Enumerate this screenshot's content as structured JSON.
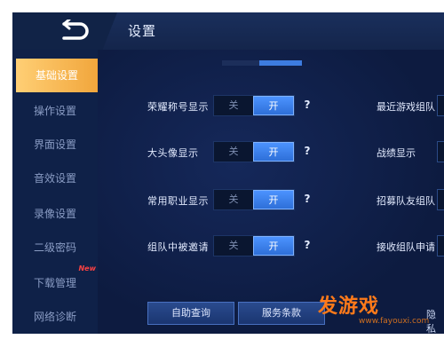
{
  "header": {
    "title": "设置"
  },
  "sidebar": {
    "items": [
      {
        "label": "基础设置",
        "active": true
      },
      {
        "label": "操作设置"
      },
      {
        "label": "界面设置"
      },
      {
        "label": "音效设置"
      },
      {
        "label": "录像设置"
      },
      {
        "label": "二级密码"
      },
      {
        "label": "下载管理",
        "badge": "New"
      },
      {
        "label": "网络诊断"
      }
    ]
  },
  "settings": {
    "toggle_off_label": "关",
    "toggle_on_label": "开",
    "help_label": "?",
    "rows": [
      {
        "label": "荣耀称号显示",
        "state": "on"
      },
      {
        "label": "大头像显示",
        "state": "on"
      },
      {
        "label": "常用职业显示",
        "state": "on"
      },
      {
        "label": "组队中被邀请",
        "state": "on"
      }
    ],
    "right_column": [
      {
        "label": "最近游戏组队"
      },
      {
        "label": "战绩显示"
      },
      {
        "label": "招募队友组队"
      },
      {
        "label": "接收组队申请"
      }
    ]
  },
  "footer": {
    "buttons": [
      {
        "label": "自助查询"
      },
      {
        "label": "服务条款"
      }
    ],
    "right_text": "隐私"
  },
  "watermark": {
    "text": "发游戏",
    "url": "www.fayouxi.com"
  },
  "colors": {
    "accent": "#f1a63c",
    "toggle_on": "#3a7fe8",
    "background": "#0c1a3a",
    "watermark": "#ff7a1a"
  }
}
